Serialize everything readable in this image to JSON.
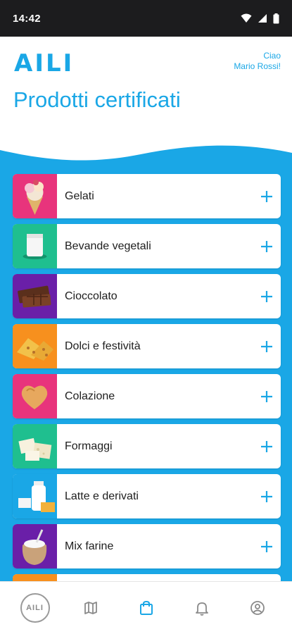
{
  "status_bar": {
    "time": "14:42"
  },
  "header": {
    "logo": "AILI",
    "greeting_line1": "Ciao",
    "greeting_line2": "Mario Rossi!",
    "title": "Prodotti certificati"
  },
  "categories": [
    {
      "label": "Gelati",
      "thumb_color": "#e8347c",
      "icon": "ice-cream-icon"
    },
    {
      "label": "Bevande vegetali",
      "thumb_color": "#1fbf8f",
      "icon": "milk-glass-icon"
    },
    {
      "label": "Cioccolato",
      "thumb_color": "#6a1fa8",
      "icon": "chocolate-icon"
    },
    {
      "label": "Dolci e festività",
      "thumb_color": "#f7901e",
      "icon": "cake-icon"
    },
    {
      "label": "Colazione",
      "thumb_color": "#e8347c",
      "icon": "biscuit-icon"
    },
    {
      "label": "Formaggi",
      "thumb_color": "#1fbf8f",
      "icon": "cheese-icon"
    },
    {
      "label": "Latte e derivati",
      "thumb_color": "#1aa7e6",
      "icon": "milk-bottle-icon"
    },
    {
      "label": "Mix farine",
      "thumb_color": "#6a1fa8",
      "icon": "flour-sack-icon"
    }
  ],
  "bottom_nav": {
    "home_logo": "AILI",
    "items": [
      "home-icon",
      "map-icon",
      "bag-icon",
      "bell-icon",
      "profile-icon"
    ],
    "active": "bag-icon"
  },
  "colors": {
    "brand": "#1aa7e6",
    "inactive": "#8a8a8a"
  }
}
